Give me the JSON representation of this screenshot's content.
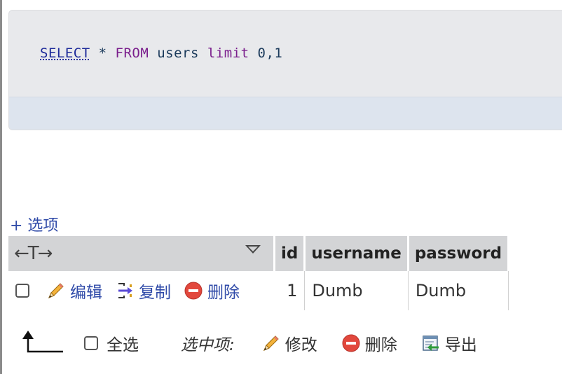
{
  "sql": {
    "kw_select": "SELECT",
    "star": "*",
    "kw_from": "FROM",
    "table": "users",
    "kw_limit": "limit",
    "limit_value": "0,1"
  },
  "options_label": "+ 选项",
  "table": {
    "nav_arrows": "←T→",
    "columns": [
      "id",
      "username",
      "password"
    ],
    "rows": [
      {
        "actions": {
          "edit": "编辑",
          "copy": "复制",
          "delete": "删除"
        },
        "id": "1",
        "username": "Dumb",
        "password": "Dumb"
      }
    ]
  },
  "bulk": {
    "check_all": "全选",
    "with_selected": "选中项:",
    "modify": "修改",
    "delete": "删除",
    "export": "导出"
  },
  "colors": {
    "link": "#2f4aa8",
    "header_bg": "#d3d4d6",
    "sql_bg": "#e8e9ec",
    "sql_bottom": "#dde4ee",
    "delete_red": "#e2483d"
  }
}
